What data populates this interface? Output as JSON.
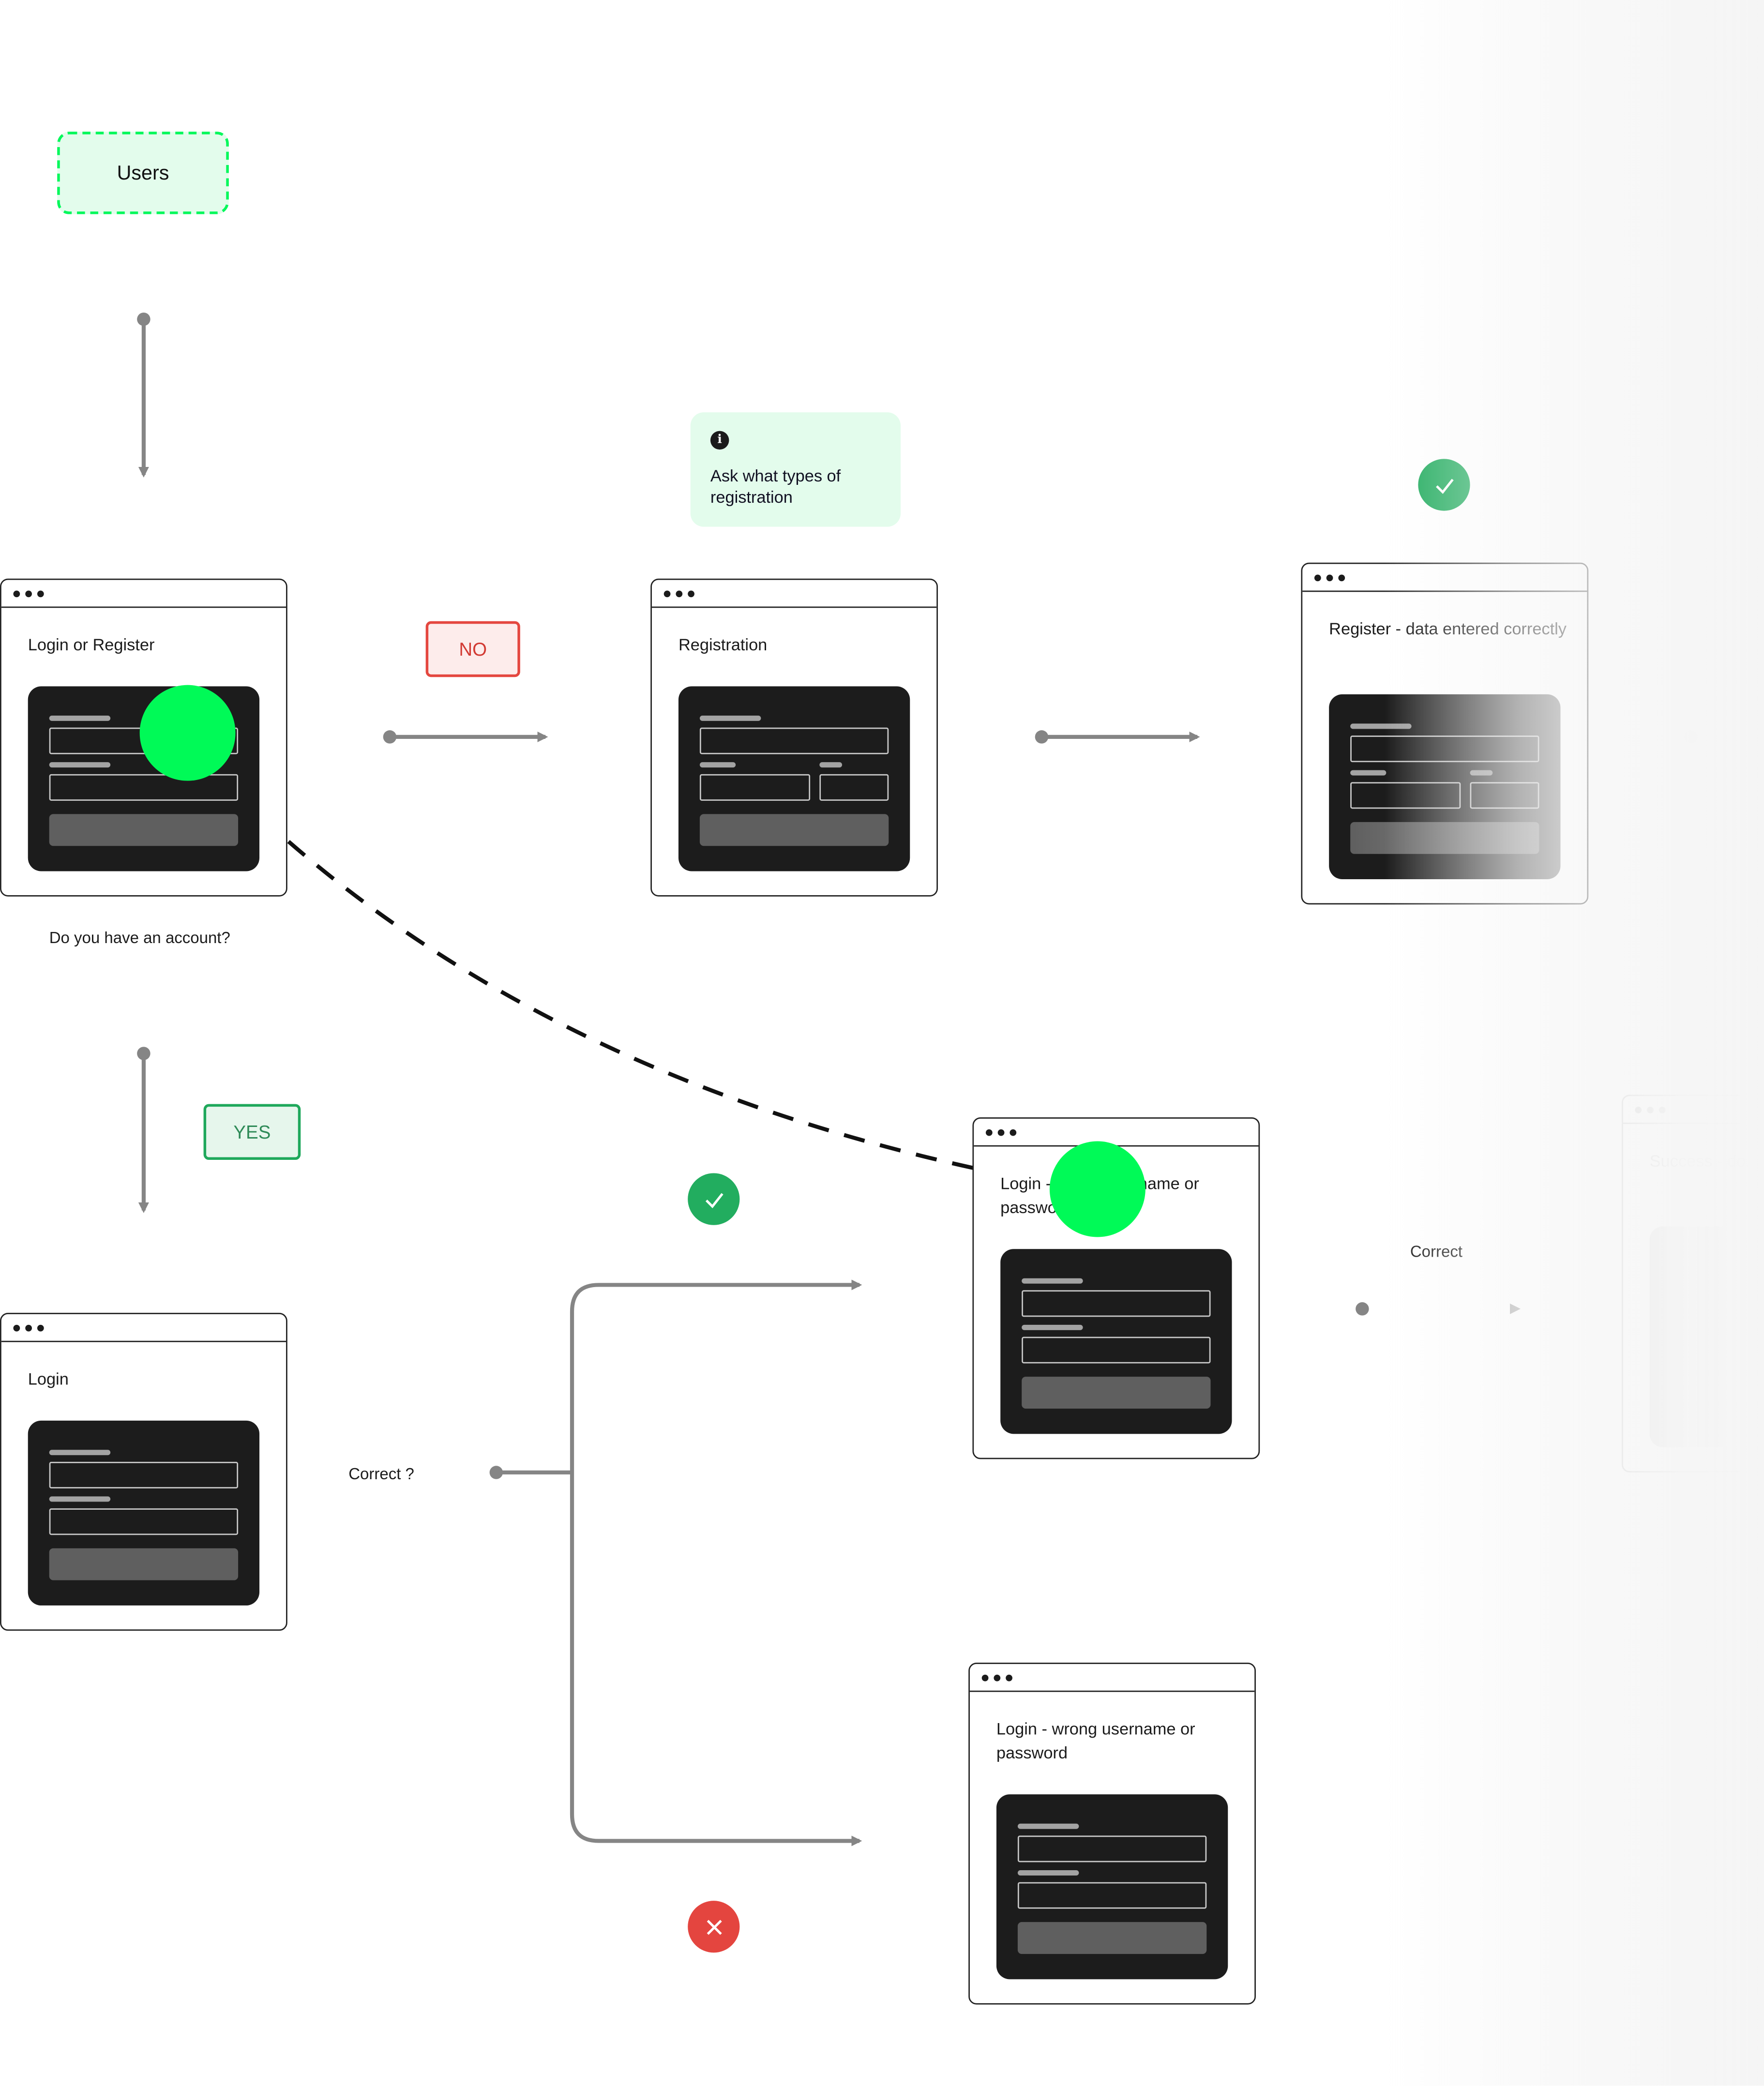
{
  "diagram": {
    "start_node": {
      "label": "Users"
    },
    "note": {
      "icon": "info-icon",
      "text": "Ask what types of registration"
    },
    "question_label": "Do you have an account?",
    "branch_labels": {
      "no": "NO",
      "yes": "YES"
    },
    "decision_label": "Correct ?",
    "edge_label_correct": "Correct",
    "colors": {
      "accent_green": "#00f85a",
      "success": "#22ad5f",
      "error": "#e4453f",
      "connector": "#858585",
      "panel_dark": "#1c1c1c"
    },
    "screens": [
      {
        "id": "login-or-register",
        "title": "Login or Register",
        "layout": "two-field"
      },
      {
        "id": "registration",
        "title": "Registration",
        "layout": "split-field"
      },
      {
        "id": "register-success",
        "title": "Register - data entered correctly",
        "layout": "split-field",
        "status": "check-icon"
      },
      {
        "id": "login",
        "title": "Login",
        "layout": "two-field"
      },
      {
        "id": "login-wrong-top",
        "title": "Login - wrong username or password",
        "layout": "two-field",
        "status": "check-icon"
      },
      {
        "id": "login-wrong-bottom",
        "title": "Login - wrong username or password",
        "layout": "two-field",
        "status": "x-icon"
      },
      {
        "id": "success",
        "title": "Success - do... successfully",
        "layout": "faded"
      }
    ]
  }
}
